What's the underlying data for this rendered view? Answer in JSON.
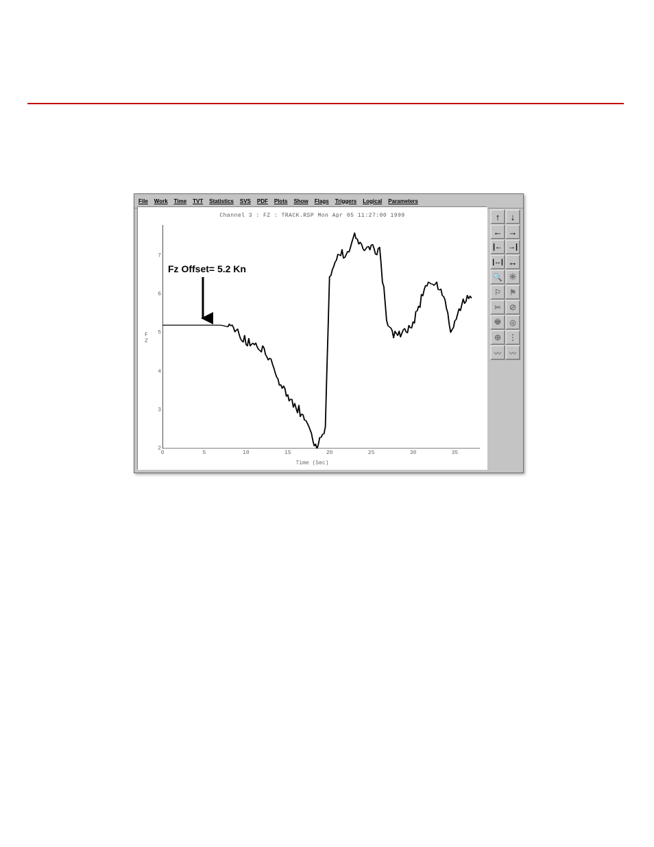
{
  "header_rule_color": "#c00000",
  "menu": [
    "File",
    "Work",
    "Time",
    "TVT",
    "Statistics",
    "SVS",
    "PDF",
    "Plots",
    "Show",
    "Flags",
    "Triggers",
    "Logical",
    "Parameters"
  ],
  "toolbar_icons": [
    "arrow-up",
    "arrow-down",
    "arrow-left",
    "arrow-right",
    "go-start",
    "go-end",
    "fit-horizontal",
    "fit-both",
    "magnify",
    "asterisk",
    "flag-left",
    "flag-right",
    "cut",
    "no-entry",
    "print",
    "disk",
    "target",
    "dots-vertical",
    "wave",
    "wave-2"
  ],
  "plot_title": "Channel 3 : FZ : TRACK.RSP Mon Apr 05 11:27:00 1999",
  "xlabel": "Time (Sec)",
  "ylabel_lines": [
    "F",
    "Z"
  ],
  "annotation": "Fz Offset= 5.2 Kn",
  "chart_data": {
    "type": "line",
    "title": "Channel 3 : FZ : TRACK.RSP Mon Apr 05 11:27:00 1999",
    "xlabel": "Time (Sec)",
    "ylabel": "FZ",
    "xlim": [
      0,
      38
    ],
    "ylim": [
      2,
      7.8
    ],
    "x_ticks": [
      0,
      5,
      10,
      15,
      20,
      25,
      30,
      35
    ],
    "y_ticks": [
      2,
      3,
      4,
      5,
      6,
      7
    ],
    "annotation": {
      "text": "Fz Offset= 5.2 Kn",
      "points_to": {
        "x": 6,
        "y": 5.2
      }
    },
    "series": [
      {
        "name": "FZ",
        "x": [
          0,
          5,
          7,
          8,
          9,
          10,
          11,
          12,
          13,
          14,
          15,
          16,
          17,
          18,
          18.5,
          19,
          19.5,
          20,
          21,
          22,
          23,
          24,
          25,
          26,
          27,
          28,
          29,
          30,
          31,
          32,
          33,
          34,
          34.5,
          35,
          36,
          37
        ],
        "values": [
          5.2,
          5.2,
          5.2,
          5.15,
          5.0,
          4.8,
          4.7,
          4.6,
          4.2,
          3.7,
          3.3,
          3.1,
          2.8,
          2.2,
          2.1,
          2.3,
          2.6,
          6.4,
          7.1,
          7.0,
          7.6,
          7.1,
          7.2,
          7.1,
          5.1,
          4.9,
          5.0,
          5.2,
          5.9,
          6.4,
          6.2,
          5.7,
          4.9,
          5.4,
          5.8,
          5.9
        ]
      }
    ]
  }
}
